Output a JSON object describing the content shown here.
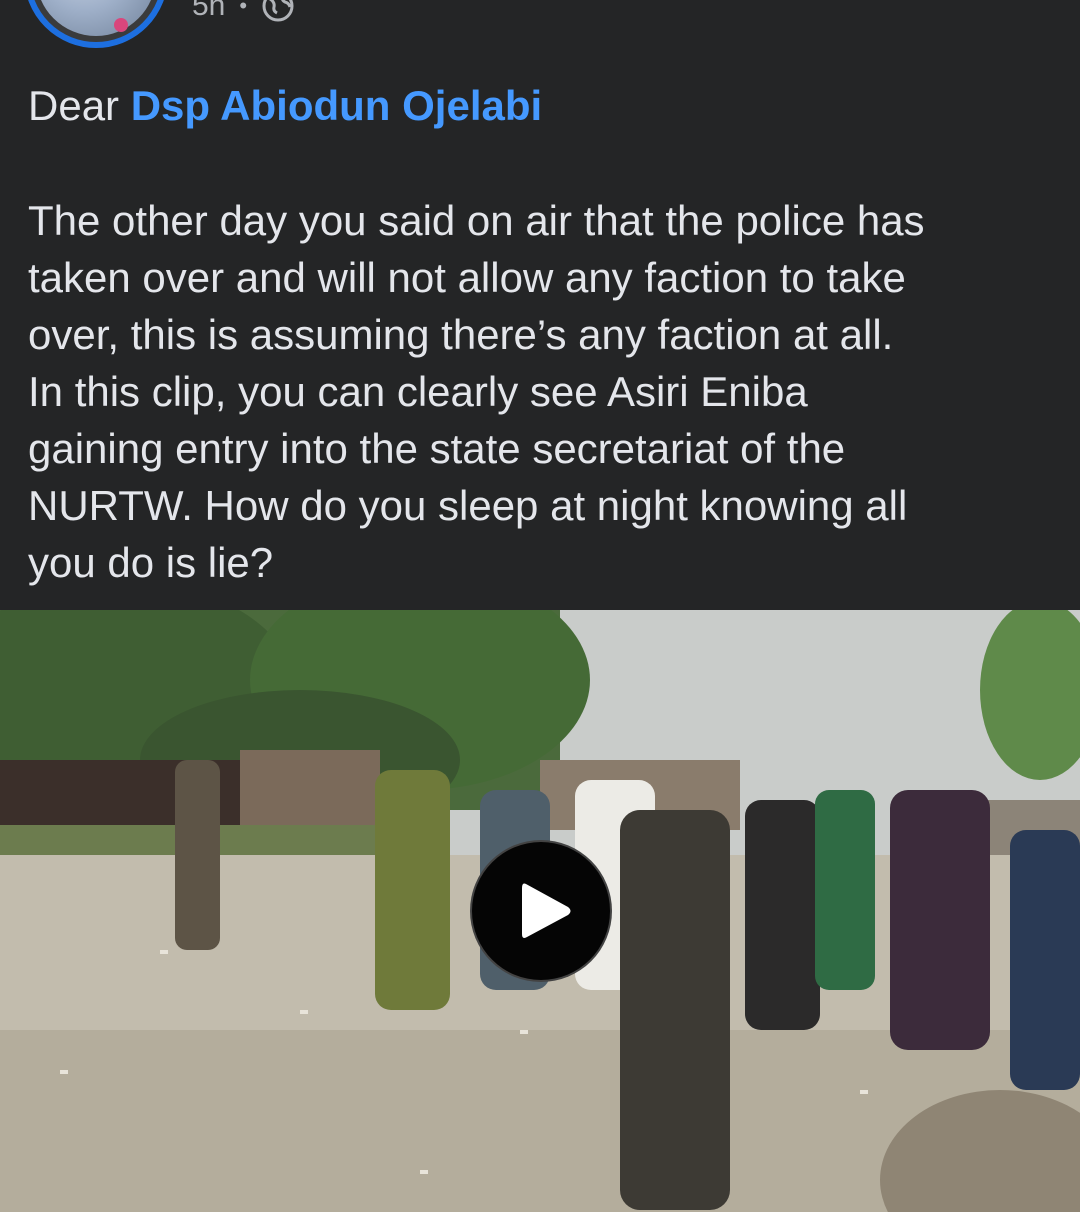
{
  "post": {
    "time": "5h",
    "separator": "•",
    "audience_icon": "globe-icon",
    "greeting_prefix": "Dear",
    "mention": "Dsp Abiodun Ojelabi",
    "body": "The other day you said on air that the police has\ntaken over and will not allow any faction to take\nover, this is assuming there’s any faction at all.\nIn this clip, you can clearly see Asiri Eniba\ngaining entry into the state secretariat of the\nNURTW. How do you sleep at night knowing all\nyou do is lie?"
  },
  "video": {
    "play_icon": "play-icon"
  },
  "colors": {
    "background": "#242526",
    "text": "#e4e6eb",
    "mention": "#4599ff",
    "meta": "#b0b3b8",
    "avatar_ring": "#1d6fe0"
  }
}
